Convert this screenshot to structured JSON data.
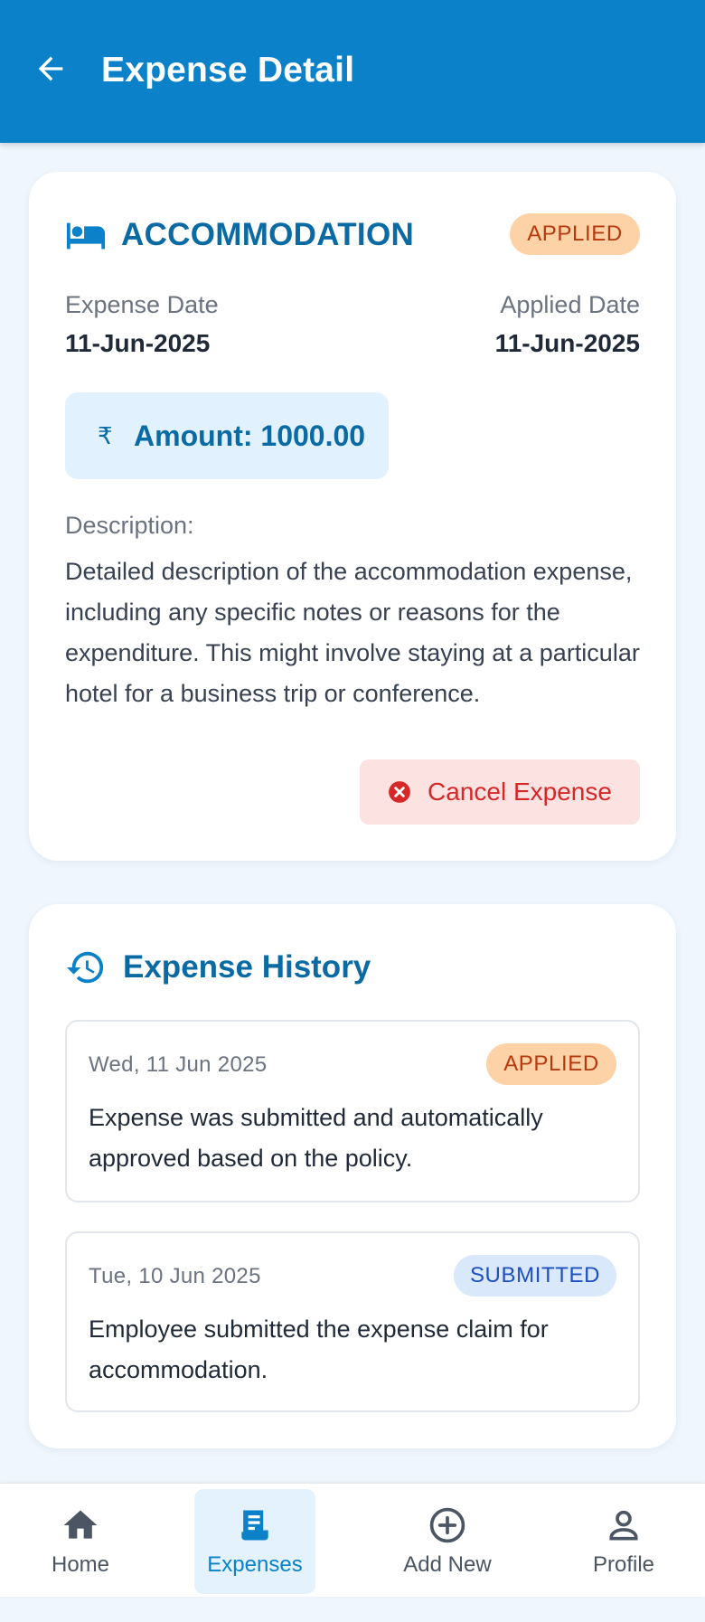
{
  "app_bar": {
    "title": "Expense Detail",
    "back_icon": "arrow-left-icon",
    "color": "#0a81c8"
  },
  "expense": {
    "category": "ACCOMMODATION",
    "category_icon": "bed-icon",
    "status": "APPLIED",
    "expense_date_label": "Expense Date",
    "expense_date": "11-Jun-2025",
    "applied_date_label": "Applied Date",
    "applied_date": "11-Jun-2025",
    "currency_symbol": "₹",
    "amount_text": "Amount: 1000.00",
    "description_label": "Description:",
    "description": "Detailed description of the accommodation expense, including any specific notes or reasons for the expenditure. This might involve staying at a particular hotel for a business trip or conference.",
    "cancel_label": "Cancel Expense"
  },
  "history": {
    "title": "Expense History",
    "icon": "history-icon",
    "items": [
      {
        "date": "Wed, 11 Jun 2025",
        "status": "APPLIED",
        "text": "Expense was submitted and automatically approved based on the policy."
      },
      {
        "date": "Tue, 10 Jun 2025",
        "status": "SUBMITTED",
        "text": "Employee submitted the expense claim for accommodation."
      }
    ]
  },
  "bottom_nav": {
    "items": [
      {
        "label": "Home",
        "icon": "home-icon",
        "active": false
      },
      {
        "label": "Expenses",
        "icon": "receipt-icon",
        "active": true
      },
      {
        "label": "Add New",
        "icon": "add-circle-icon",
        "active": false
      },
      {
        "label": "Profile",
        "icon": "person-icon",
        "active": false
      }
    ]
  },
  "colors": {
    "accent": "#0a6aa3",
    "applied_bg": "#fdd2a6",
    "applied_text": "#b5390f",
    "submitted_bg": "#d9e8fb",
    "submitted_text": "#1d4fbf",
    "cancel_bg": "#fde2e2",
    "cancel_text": "#d62828"
  }
}
